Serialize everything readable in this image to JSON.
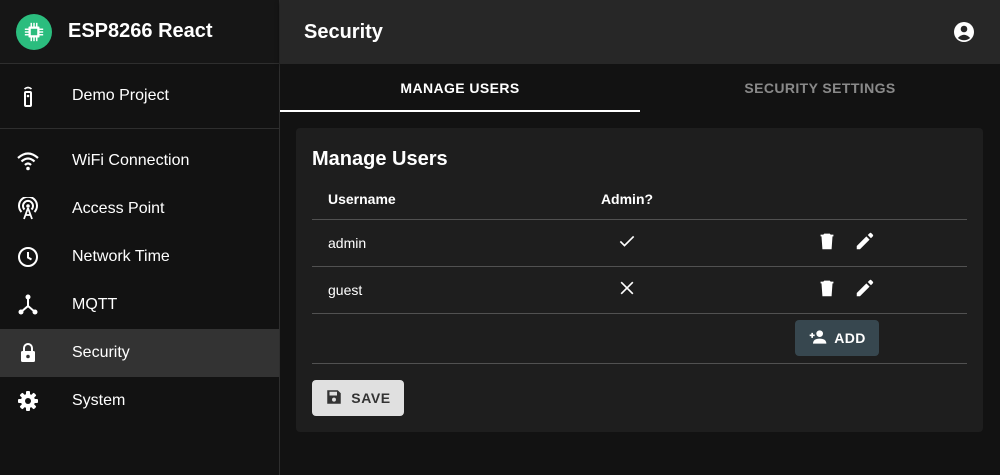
{
  "app": {
    "title": "ESP8266 React"
  },
  "sidebar": {
    "demo": {
      "label": "Demo Project",
      "icon": "remote-icon"
    },
    "items": [
      {
        "label": "WiFi Connection",
        "icon": "wifi-icon"
      },
      {
        "label": "Access Point",
        "icon": "access-point-icon"
      },
      {
        "label": "Network Time",
        "icon": "clock-icon"
      },
      {
        "label": "MQTT",
        "icon": "device-hub-icon"
      },
      {
        "label": "Security",
        "icon": "lock-icon",
        "active": true
      },
      {
        "label": "System",
        "icon": "gear-icon"
      }
    ]
  },
  "header": {
    "title": "Security",
    "account_icon": "account-circle-icon"
  },
  "tabs": [
    {
      "label": "MANAGE USERS",
      "active": true
    },
    {
      "label": "SECURITY SETTINGS",
      "active": false
    }
  ],
  "manage_users": {
    "title": "Manage Users",
    "columns": {
      "username": "Username",
      "admin": "Admin?"
    },
    "rows": [
      {
        "username": "admin",
        "admin": true,
        "admin_icon": "check-icon"
      },
      {
        "username": "guest",
        "admin": false,
        "admin_icon": "close-icon"
      }
    ],
    "add_label": "ADD",
    "save_label": "SAVE"
  },
  "colors": {
    "brand": "#2bbd7e",
    "add_button": "#37474f",
    "save_button": "#e0e0e0",
    "active_nav": "#333333"
  }
}
